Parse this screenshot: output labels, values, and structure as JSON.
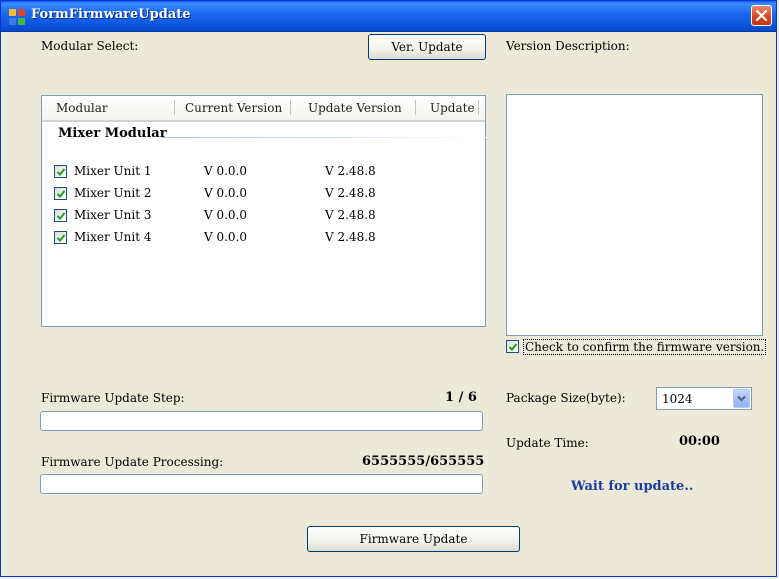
{
  "window": {
    "title": "FormFirmwareUpdate"
  },
  "modular_select": {
    "label": "Modular Select:",
    "ver_update_button": "Ver. Update"
  },
  "listview": {
    "columns": [
      "Modular",
      "Current Version",
      "Update Version",
      "Update"
    ],
    "group": "Mixer Modular",
    "rows": [
      {
        "name": "Mixer Unit 1",
        "current": "V 0.0.0",
        "update": "V 2.48.8",
        "checked": true
      },
      {
        "name": "Mixer Unit 2",
        "current": "V 0.0.0",
        "update": "V 2.48.8",
        "checked": true
      },
      {
        "name": "Mixer Unit 3",
        "current": "V 0.0.0",
        "update": "V 2.48.8",
        "checked": true
      },
      {
        "name": "Mixer Unit 4",
        "current": "V 0.0.0",
        "update": "V 2.48.8",
        "checked": true
      }
    ]
  },
  "version_description": {
    "label": "Version Description:",
    "confirm_checkbox_label": "Check to confirm the firmware version.",
    "confirm_checked": true
  },
  "firmware_step": {
    "label": "Firmware Update Step:",
    "value": "1 / 6",
    "progress": 0
  },
  "firmware_processing": {
    "label": "Firmware Update Processing:",
    "value": "6555555/655555",
    "progress": 0
  },
  "package_size": {
    "label": "Package Size(byte):",
    "selected": "1024"
  },
  "update_time": {
    "label": "Update Time:",
    "value": "00:00"
  },
  "status": {
    "text": "Wait for update.."
  },
  "firmware_update_button": "Firmware Update",
  "colors": {
    "titlebar": "#0a53d9",
    "status_text": "#1b3ea0",
    "check": "#21a121"
  }
}
